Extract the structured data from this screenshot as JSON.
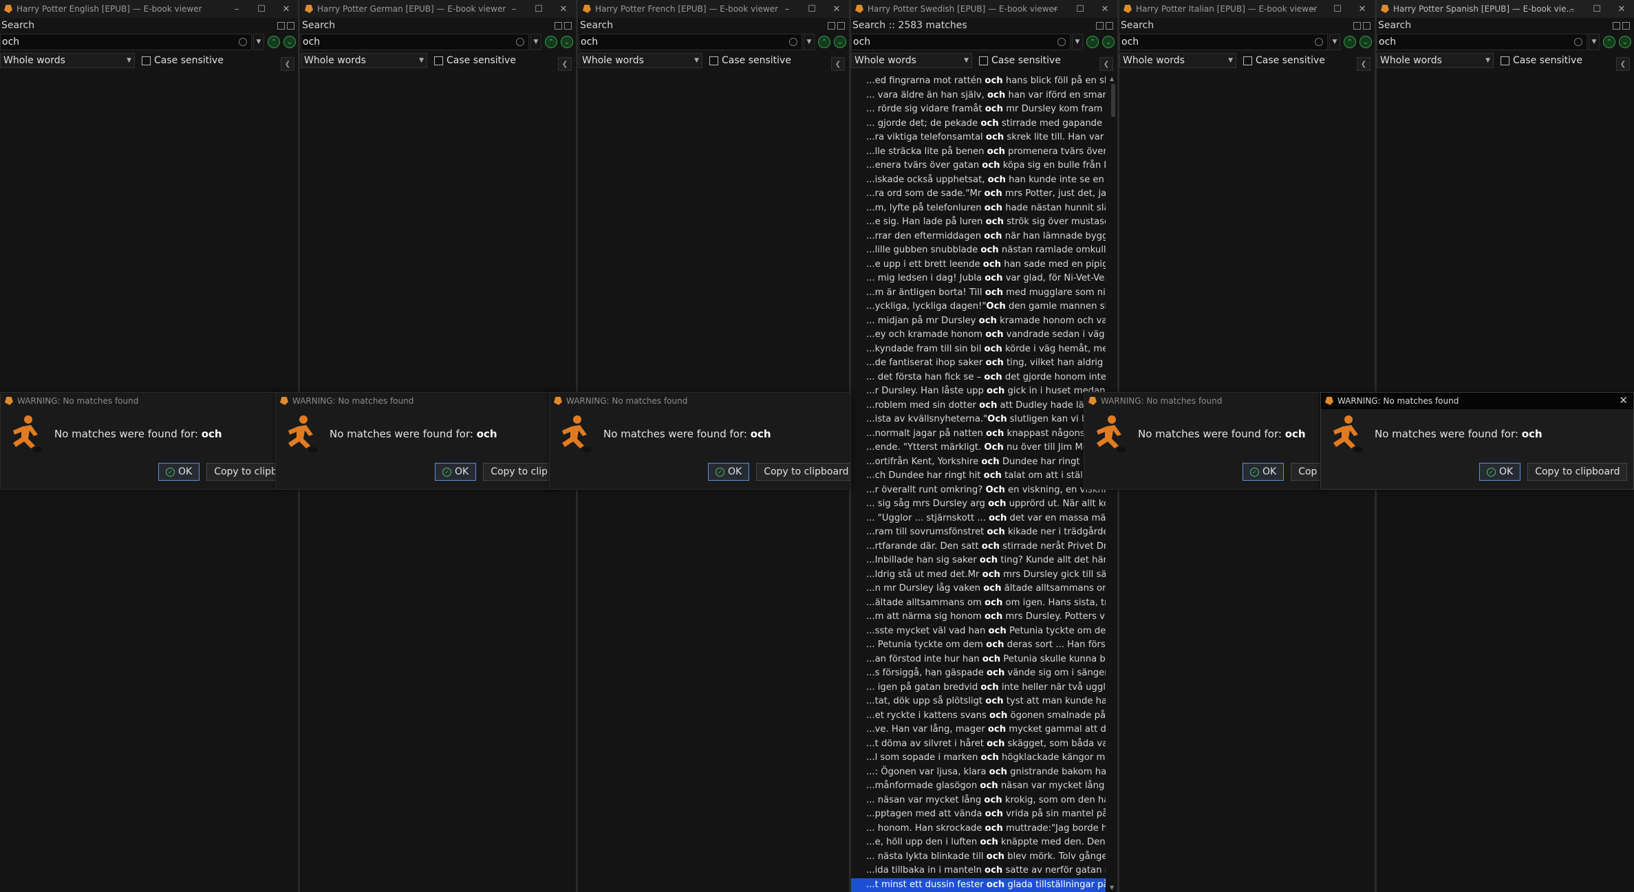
{
  "windows": [
    {
      "title": "Harry Potter English [EPUB] — E-book viewer",
      "panel_title": "Search",
      "query": "och",
      "mode": "Whole words",
      "case_label": "Case sensitive"
    },
    {
      "title": "Harry Potter German [EPUB] — E-book viewer",
      "panel_title": "Search",
      "query": "och",
      "mode": "Whole words",
      "case_label": "Case sensitive"
    },
    {
      "title": "Harry Potter French [EPUB] — E-book viewer",
      "panel_title": "Search",
      "query": "och",
      "mode": "Whole words",
      "case_label": "Case sensitive"
    },
    {
      "title": "Harry Potter Swedish [EPUB] — E-book viewer",
      "panel_title": "Search :: 2583 matches",
      "query": "och",
      "mode": "Whole words",
      "case_label": "Case sensitive"
    },
    {
      "title": "Harry Potter Italian [EPUB] — E-book viewer",
      "panel_title": "Search",
      "query": "och",
      "mode": "Whole words",
      "case_label": "Case sensitive"
    },
    {
      "title": "Harry Potter Spanish [EPUB] — E-book vie...",
      "panel_title": "Search",
      "query": "och",
      "mode": "Whole words",
      "case_label": "Case sensitive"
    }
  ],
  "dialogs": [
    {
      "title": "WARNING: No matches found",
      "message": "No matches were found for:",
      "term": "och",
      "ok": "OK",
      "copy": "Copy to clipb"
    },
    {
      "title": "WARNING: No matches found",
      "message": "No matches were found for:",
      "term": "och",
      "ok": "OK",
      "copy": "Copy to clip"
    },
    {
      "title": "WARNING: No matches found",
      "message": "No matches were found for:",
      "term": "och",
      "ok": "OK",
      "copy": "Copy to clipboard"
    },
    {
      "title": "WARNING: No matches found",
      "message": "No matches were found for:",
      "term": "och",
      "ok": "OK",
      "copy": "Cop"
    },
    {
      "title": "WARNING: No matches found",
      "message": "No matches were found for:",
      "term": "och",
      "ok": "OK",
      "copy": "Copy to clipboard"
    }
  ],
  "results": [
    {
      "pre": "...ed fingrarna mot rattén ",
      "hit": "och",
      "post": " hans blick föll på en sk..."
    },
    {
      "pre": "... vara äldre än han själv, ",
      "hit": "och",
      "post": " han var iförd en smarag..."
    },
    {
      "pre": "... rörde sig vidare framåt ",
      "hit": "och",
      "post": " mr Dursley kom fram til..."
    },
    {
      "pre": "... gjorde det; de pekade ",
      "hit": "och",
      "post": " stirrade med gapande ..."
    },
    {
      "pre": "...ra viktiga telefonsamtal ",
      "hit": "och",
      "post": " skrek lite till. Han var p..."
    },
    {
      "pre": "...lle sträcka lite på benen ",
      "hit": "och",
      "post": " promenera tvärs över g..."
    },
    {
      "pre": "...enera tvärs över gatan ",
      "hit": "och",
      "post": " köpa sig en bulle från b..."
    },
    {
      "pre": "...iskade också upphetsat, ",
      "hit": "och",
      "post": " han kunde inte se en en..."
    },
    {
      "pre": "...ra ord som de sade.\"Mr ",
      "hit": "och",
      "post": " mrs Potter, just det, jag ..."
    },
    {
      "pre": "...m, lyfte på telefonluren ",
      "hit": "och",
      "post": " hade nästan hunnit slå ..."
    },
    {
      "pre": "...e sig. Han lade på luren ",
      "hit": "och",
      "post": " strök sig över mustasch..."
    },
    {
      "pre": "...rrar den eftermiddagen ",
      "hit": "och",
      "post": " när han lämnade byggn..."
    },
    {
      "pre": "...lille gubben snubblade ",
      "hit": "och",
      "post": " nästan ramlade omkull...."
    },
    {
      "pre": "...e upp i ett brett leende ",
      "hit": "och",
      "post": " han sade med en pipig ..."
    },
    {
      "pre": "... mig ledsen i dag! Jubla ",
      "hit": "och",
      "post": " var glad, för Ni-Vet-Ve..."
    },
    {
      "pre": "...m är äntligen borta! Till ",
      "hit": "och",
      "post": " med mugglare som ni ..."
    },
    {
      "pre": "...yckliga, lyckliga dagen!\"",
      "hit": "Och",
      "post": " den gamle mannen slo..."
    },
    {
      "pre": "... midjan på mr Dursley ",
      "hit": "och",
      "post": " kramade honom och va..."
    },
    {
      "pre": "...ey och kramade honom ",
      "hit": "och",
      "post": " vandrade sedan i väg.M..."
    },
    {
      "pre": "...kyndade fram till sin bil ",
      "hit": "och",
      "post": " körde i väg hemåt, med..."
    },
    {
      "pre": "...de fantiserat ihop saker ",
      "hit": "och",
      "post": " ting, vilket han aldrig ti..."
    },
    {
      "pre": "... det första han fick se – ",
      "hit": "och",
      "post": " det gjorde honom inte ..."
    },
    {
      "pre": "...r Dursley. Han låste upp ",
      "hit": "och",
      "post": " gick in i huset medan h..."
    },
    {
      "pre": "...roblem med sin dotter ",
      "hit": "och",
      "post": " att Dudley hade lärt sig..."
    },
    {
      "pre": "...ista av kvällsnyheterna.\"",
      "hit": "Och",
      "post": " slutligen kan vi berätta..."
    },
    {
      "pre": "...normalt jagar på natten ",
      "hit": "och",
      "post": " knappast någonsin vis..."
    },
    {
      "pre": "...ende. \"Ytterst märkligt. ",
      "hit": "Och",
      "post": " nu över till Jim McGuff..."
    },
    {
      "pre": "...ortifrån Kent, Yorkshire ",
      "hit": "och",
      "post": " Dundee har ringt hit o..."
    },
    {
      "pre": "...ch Dundee har ringt hit ",
      "hit": "och",
      "post": " talat om att i stället fö..."
    },
    {
      "pre": "...r överallt runt omkring? ",
      "hit": "Och",
      "post": " en viskning, en viskning..."
    },
    {
      "pre": "... sig såg mrs Dursley arg ",
      "hit": "och",
      "post": " upprörd ut. När allt ko..."
    },
    {
      "pre": "... \"Ugglor ... stjärnskott ... ",
      "hit": "och",
      "post": " det var en massa männi..."
    },
    {
      "pre": "...ram till sovrumsfönstret ",
      "hit": "och",
      "post": " kikade ner i trädgården..."
    },
    {
      "pre": "...rtfarande där. Den satt ",
      "hit": "och",
      "post": " stirrade neråt Privet Dri..."
    },
    {
      "pre": "...Inbillade han sig saker ",
      "hit": "och",
      "post": " ting? Kunde allt det här..."
    },
    {
      "pre": "...ldrig stå ut med det.Mr ",
      "hit": "och",
      "post": " mrs Dursley gick till sän..."
    },
    {
      "pre": "...n mr Dursley låg vaken ",
      "hit": "och",
      "post": " ältade alltsammans om..."
    },
    {
      "pre": "...ältade alltsammans om ",
      "hit": "och",
      "post": " om igen. Hans sista, trö..."
    },
    {
      "pre": "...m att närma sig honom ",
      "hit": "och",
      "post": " mrs Dursley. Potters viss..."
    },
    {
      "pre": "...sste mycket väl vad han ",
      "hit": "och",
      "post": " Petunia tyckte om dem ..."
    },
    {
      "pre": "... Petunia tyckte om dem ",
      "hit": "och",
      "post": " deras sort ... Han försto..."
    },
    {
      "pre": "...an förstod inte hur han ",
      "hit": "och",
      "post": " Petunia skulle kunna bli ..."
    },
    {
      "pre": "...s försiggå, han gäspade ",
      "hit": "och",
      "post": " vände sig om i sängen, ..."
    },
    {
      "pre": "... igen på gatan bredvid ",
      "hit": "och",
      "post": " inte heller när två uggl..."
    },
    {
      "pre": "...tat, dök upp så plötsligt ",
      "hit": "och",
      "post": " tyst att man kunde ha tr..."
    },
    {
      "pre": "...et ryckte i kattens svans ",
      "hit": "och",
      "post": " ögonen smalnade på d..."
    },
    {
      "pre": "...ve. Han var lång, mager ",
      "hit": "och",
      "post": " mycket gammal att dö..."
    },
    {
      "pre": "...t döma av silvret i håret ",
      "hit": "och",
      "post": " skägget, som båda var l..."
    },
    {
      "pre": "...l som sopade i marken ",
      "hit": "och",
      "post": " högklackade kängor m..."
    },
    {
      "pre": "...: Ögonen var ljusa, klara ",
      "hit": "och",
      "post": " gnistrande bakom halv..."
    },
    {
      "pre": "...månformade glasögon ",
      "hit": "och",
      "post": " näsan var mycket lång ..."
    },
    {
      "pre": "... näsan var mycket lång ",
      "hit": "och",
      "post": " krokig, som om den ha..."
    },
    {
      "pre": "...pptagen med att vända ",
      "hit": "och",
      "post": " vrida på sin mantel på j..."
    },
    {
      "pre": "... honom. Han skrockade ",
      "hit": "och",
      "post": " muttrade:\"Jag borde ha..."
    },
    {
      "pre": "...e, höll upp den i luften ",
      "hit": "och",
      "post": " knäppte med den. Den ..."
    },
    {
      "pre": "... nästa lykta blinkade till ",
      "hit": "och",
      "post": " blev mörk. Tolv gånger ..."
    },
    {
      "pre": "...ida tillbaka in i manteln ",
      "hit": "och",
      "post": " satte av nerför gatan m..."
    },
    {
      "pre": "...t minst ett dussin fester ",
      "hit": "och",
      "post": " glada tillställningar på ..."
    }
  ]
}
